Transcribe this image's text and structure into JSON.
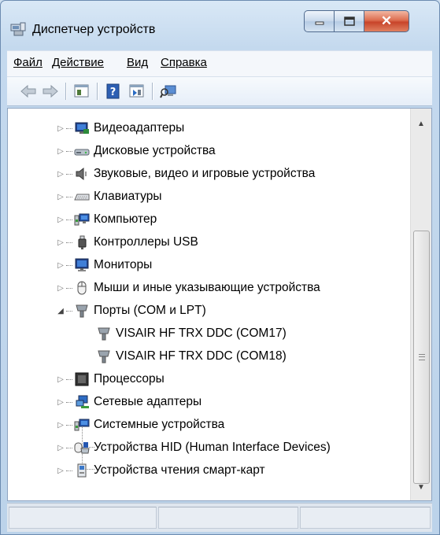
{
  "window": {
    "title": "Диспетчер устройств",
    "title_icon": "device-manager-icon"
  },
  "caption": {
    "minimize": "▁",
    "maximize": "☐",
    "close": "✕"
  },
  "menu": [
    {
      "label": "Файл"
    },
    {
      "label": "Действие"
    },
    {
      "label": "Вид"
    },
    {
      "label": "Справка"
    }
  ],
  "toolbar": [
    "back-arrow-icon",
    "forward-arrow-icon",
    "properties-icon",
    "help-icon",
    "show-hidden-icon",
    "scan-hardware-icon"
  ],
  "tree": {
    "nodes": [
      {
        "label": "Видеоадаптеры",
        "icon": "display-adapter-icon",
        "expanded": false
      },
      {
        "label": "Дисковые устройства",
        "icon": "disk-drive-icon",
        "expanded": false
      },
      {
        "label": "Звуковые, видео и игровые устройства",
        "icon": "speaker-icon",
        "expanded": false
      },
      {
        "label": "Клавиатуры",
        "icon": "keyboard-icon",
        "expanded": false
      },
      {
        "label": "Компьютер",
        "icon": "computer-icon",
        "expanded": false
      },
      {
        "label": "Контроллеры USB",
        "icon": "usb-icon",
        "expanded": false
      },
      {
        "label": "Мониторы",
        "icon": "monitor-icon",
        "expanded": false
      },
      {
        "label": "Мыши и иные указывающие устройства",
        "icon": "mouse-icon",
        "expanded": false
      },
      {
        "label": "Порты (COM и LPT)",
        "icon": "port-icon",
        "expanded": true
      },
      {
        "label": "VISAIR HF TRX DDC (COM17)",
        "icon": "port-icon",
        "child": true
      },
      {
        "label": "VISAIR HF TRX DDC (COM18)",
        "icon": "port-icon",
        "child": true
      },
      {
        "label": "Процессоры",
        "icon": "processor-icon",
        "expanded": false
      },
      {
        "label": "Сетевые адаптеры",
        "icon": "network-icon",
        "expanded": false
      },
      {
        "label": "Системные устройства",
        "icon": "system-icon",
        "expanded": false
      },
      {
        "label": "Устройства HID (Human Interface Devices)",
        "icon": "hid-icon",
        "expanded": false
      },
      {
        "label": "Устройства чтения смарт-карт",
        "icon": "smartcard-icon",
        "expanded": false
      }
    ]
  },
  "colors": {
    "frame": "#bcd3ea",
    "close": "#c8442a",
    "tree_bg": "#ffffff"
  }
}
